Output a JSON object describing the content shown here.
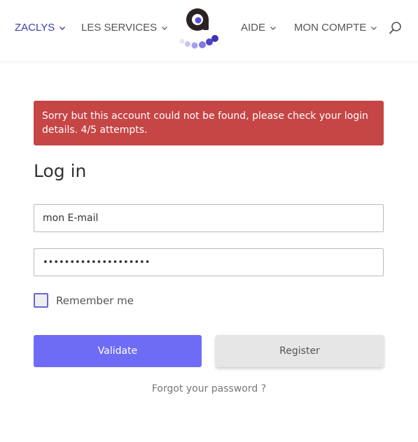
{
  "nav": {
    "items": [
      {
        "label": "ZACLYS"
      },
      {
        "label": "LES SERVICES"
      },
      {
        "label": "AIDE"
      },
      {
        "label": "MON COMPTE"
      }
    ]
  },
  "colors": {
    "accent": "#6e6cf5",
    "nav_active": "#3a3fa8",
    "alert_bg": "#c64545",
    "logo_dark": "#2b2323"
  },
  "icons": {
    "search": "search-icon",
    "chevron": "chevron-down-icon",
    "logo": "zaclys-logo"
  },
  "alert": {
    "message": "Sorry but this account could not be found, please check your login details. 4/5 attempts."
  },
  "login": {
    "title": "Log in",
    "email_value": "mon E-mail",
    "password_value": "••••••••••••••••••••",
    "remember_label": "Remember me",
    "remember_checked": false,
    "validate_label": "Validate",
    "register_label": "Register",
    "forgot_label": "Forgot your password ?"
  }
}
